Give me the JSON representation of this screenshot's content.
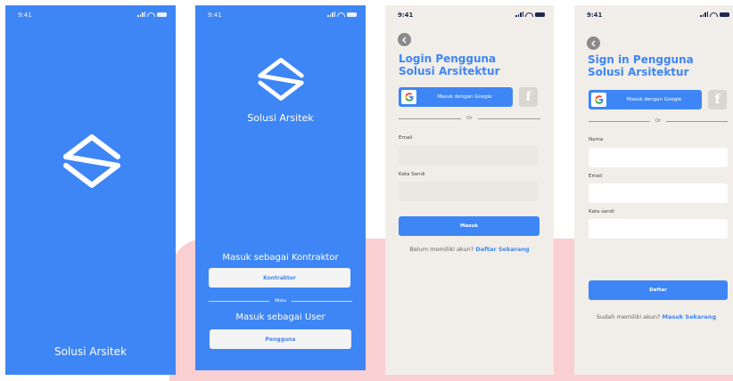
{
  "status_bar": {
    "time": "9:41"
  },
  "splash": {
    "app_name": "Solusi Arsitek"
  },
  "role_select": {
    "app_name": "Solusi Arsitek",
    "contractor_heading": "Masuk sebagai Kontraktor",
    "contractor_button": "Kontraktor",
    "divider": "Atau",
    "user_heading": "Masuk sebagai User",
    "user_button": "Pengguna"
  },
  "login": {
    "title_line1": "Login Pengguna",
    "title_line2": "Solusi Arsitektur",
    "google_button": "Masuk dengan Google",
    "facebook_icon": "f",
    "divider": "Or",
    "email_label": "Email",
    "password_label": "Kata Sandi",
    "submit_button": "Masuk",
    "footer_text": "Belum memiliki akun?",
    "footer_link": "Daftar Sekarang"
  },
  "signup": {
    "title_line1": "Sign in Pengguna",
    "title_line2": "Solusi Arsitektur",
    "google_button": "Masuk dengan Google",
    "facebook_icon": "f",
    "divider": "Or",
    "name_label": "Nama",
    "email_label": "Email",
    "password_label": "Kata sandi",
    "submit_button": "Daftar",
    "footer_text": "Sudah memiliki akun?",
    "footer_link": "Masuk Sekarang"
  },
  "icons": {
    "logo": "app-logo-icon",
    "back": "back-arrow-icon",
    "google": "google-icon",
    "facebook": "facebook-icon",
    "signal": "signal-icon",
    "wifi": "wifi-icon",
    "battery": "battery-icon"
  },
  "colors": {
    "brand_blue": "#3e86f5",
    "cream": "#f1ede8",
    "pink_blob": "#f9cfd2",
    "title_navy": "#1d2b4f"
  }
}
